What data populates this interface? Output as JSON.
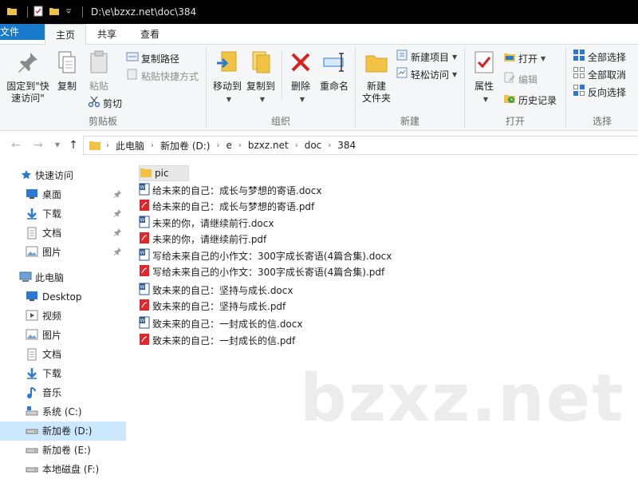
{
  "window": {
    "title": "D:\\e\\bzxz.net\\doc\\384"
  },
  "tabs": {
    "file": "文件",
    "home": "主页",
    "share": "共享",
    "view": "查看"
  },
  "ribbon": {
    "clipboard": {
      "label": "剪贴板",
      "pin_quick_access_line1": "固定到\"快",
      "pin_quick_access_line2": "速访问\"",
      "copy": "复制",
      "paste": "粘贴",
      "copy_path": "复制路径",
      "paste_shortcut": "粘贴快捷方式",
      "cut": "剪切"
    },
    "organize": {
      "label": "组织",
      "move_to": "移动到",
      "copy_to": "复制到",
      "delete": "删除",
      "rename": "重命名"
    },
    "new": {
      "label": "新建",
      "new_folder_line1": "新建",
      "new_folder_line2": "文件夹",
      "new_item": "新建项目",
      "easy_access": "轻松访问"
    },
    "open": {
      "label": "打开",
      "properties": "属性",
      "open": "打开",
      "edit": "编辑",
      "history": "历史记录"
    },
    "select": {
      "label": "选择",
      "select_all": "全部选择",
      "select_none": "全部取消",
      "invert": "反向选择"
    }
  },
  "address": {
    "crumbs": [
      "此电脑",
      "新加卷 (D:)",
      "e",
      "bzxz.net",
      "doc",
      "384"
    ]
  },
  "nav": {
    "quick_access": "快速访问",
    "desktop": "桌面",
    "downloads": "下载",
    "documents": "文档",
    "pictures": "图片",
    "this_pc": "此电脑",
    "desktop_en": "Desktop",
    "videos": "视频",
    "pictures2": "图片",
    "documents2": "文档",
    "downloads2": "下载",
    "music": "音乐",
    "drive_c": "系统 (C:)",
    "drive_d": "新加卷 (D:)",
    "drive_e": "新加卷 (E:)",
    "drive_f": "本地磁盘 (F:)"
  },
  "files": [
    {
      "name": "pic",
      "type": "folder"
    },
    {
      "name": "给未来的自己：成长与梦想的寄语.docx",
      "type": "docx"
    },
    {
      "name": "给未来的自己：成长与梦想的寄语.pdf",
      "type": "pdf"
    },
    {
      "name": "未来的你，请继续前行.docx",
      "type": "docx"
    },
    {
      "name": "未来的你，请继续前行.pdf",
      "type": "pdf"
    },
    {
      "name": "写给未来自己的小作文：300字成长寄语(4篇合集).docx",
      "type": "docx"
    },
    {
      "name": "写给未来自己的小作文：300字成长寄语(4篇合集).pdf",
      "type": "pdf"
    },
    {
      "name": "致未来的自己：坚持与成长.docx",
      "type": "docx"
    },
    {
      "name": "致未来的自己：坚持与成长.pdf",
      "type": "pdf"
    },
    {
      "name": "致未来的自己：一封成长的信.docx",
      "type": "docx"
    },
    {
      "name": "致未来的自己：一封成长的信.pdf",
      "type": "pdf"
    }
  ],
  "watermark": "bzxz.net"
}
